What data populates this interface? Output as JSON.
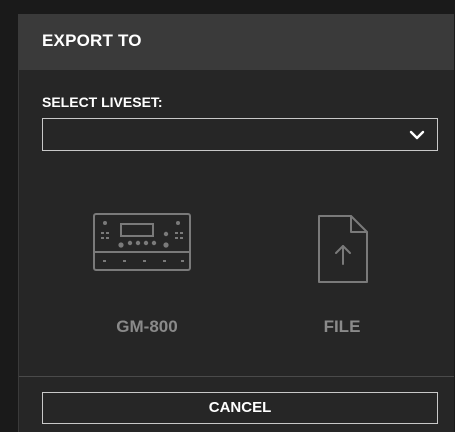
{
  "dialog": {
    "title": "EXPORT TO",
    "select_label": "SELECT LIVESET:",
    "select_value": "",
    "options": [
      {
        "label": "GM-800",
        "icon": "gm-800-device-icon"
      },
      {
        "label": "FILE",
        "icon": "file-upload-icon"
      }
    ],
    "cancel_label": "CANCEL"
  },
  "colors": {
    "background": "#262626",
    "header": "#3a3a3a",
    "text": "#ffffff",
    "muted": "#8a8a8a",
    "border": "#c8c8c8"
  }
}
